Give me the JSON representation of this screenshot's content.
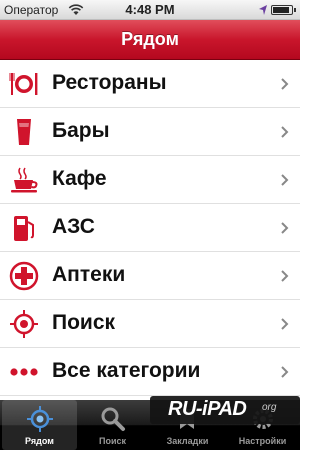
{
  "status_bar": {
    "carrier": "Оператор",
    "time": "4:48 PM",
    "battery_level": 0.9
  },
  "nav_bar": {
    "title": "Рядом"
  },
  "categories": [
    {
      "label": "Рестораны",
      "icon": "restaurant-icon"
    },
    {
      "label": "Бары",
      "icon": "beer-glass-icon"
    },
    {
      "label": "Кафе",
      "icon": "coffee-cup-icon"
    },
    {
      "label": "АЗС",
      "icon": "gas-pump-icon"
    },
    {
      "label": "Аптеки",
      "icon": "pharmacy-cross-icon"
    },
    {
      "label": "Поиск",
      "icon": "crosshair-icon"
    },
    {
      "label": "Все категории",
      "icon": "more-dots-icon"
    }
  ],
  "tab_bar": {
    "tabs": [
      {
        "label": "Рядом",
        "icon": "crosshair-icon",
        "selected": true
      },
      {
        "label": "Поиск",
        "icon": "search-icon",
        "selected": false
      },
      {
        "label": "Закладки",
        "icon": "bookmarks-icon",
        "selected": false
      },
      {
        "label": "Настройки",
        "icon": "settings-icon",
        "selected": false
      }
    ]
  },
  "watermark": {
    "text": "RU-iPAD",
    "suffix": "org"
  },
  "colors": {
    "accent": "#c9162c",
    "icon_red": "#d0142c",
    "tab_selected_blue": "#4a90d9"
  }
}
